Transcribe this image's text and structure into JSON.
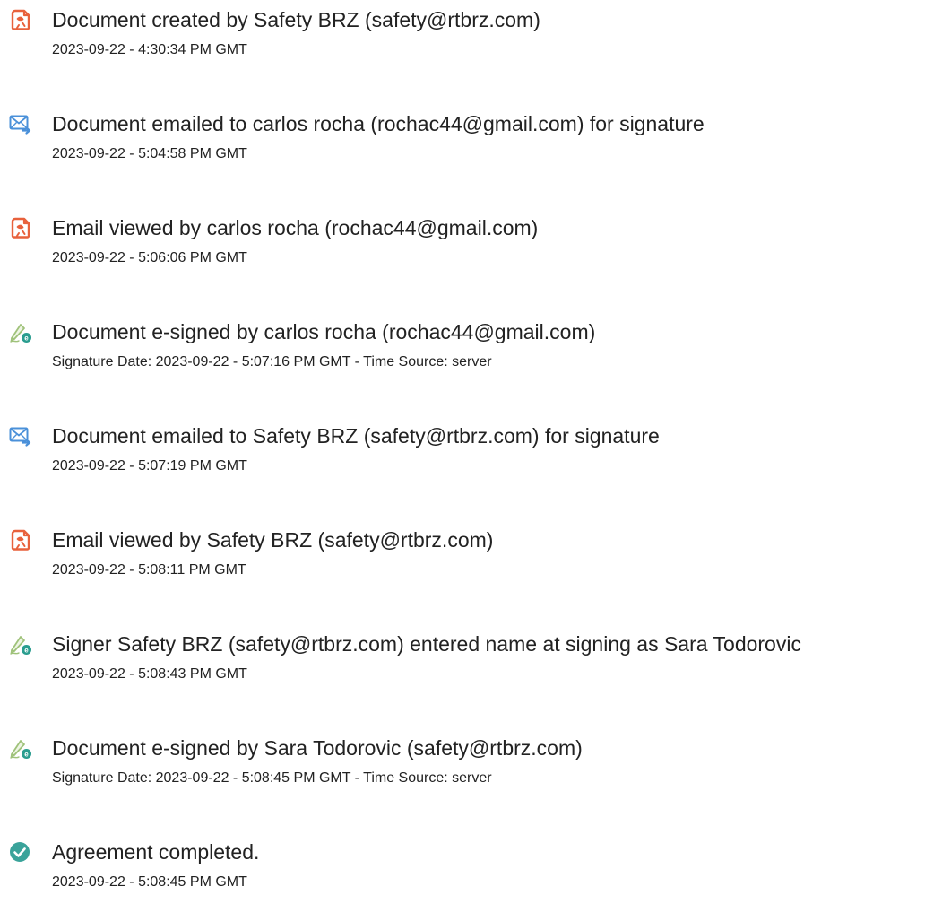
{
  "events": [
    {
      "icon": "document-created-icon",
      "title": "Document created by Safety BRZ (safety@rtbrz.com)",
      "meta": "2023-09-22 - 4:30:34 PM GMT"
    },
    {
      "icon": "email-sent-icon",
      "title": "Document emailed to carlos rocha (rochac44@gmail.com) for signature",
      "meta": "2023-09-22 - 5:04:58 PM GMT"
    },
    {
      "icon": "document-viewed-icon",
      "title": "Email viewed by carlos rocha (rochac44@gmail.com)",
      "meta": "2023-09-22 - 5:06:06 PM GMT"
    },
    {
      "icon": "e-signed-icon",
      "title": "Document e-signed by carlos rocha (rochac44@gmail.com)",
      "meta": "Signature Date: 2023-09-22 - 5:07:16 PM GMT - Time Source: server"
    },
    {
      "icon": "email-sent-icon",
      "title": "Document emailed to Safety BRZ (safety@rtbrz.com) for signature",
      "meta": "2023-09-22 - 5:07:19 PM GMT"
    },
    {
      "icon": "document-viewed-icon",
      "title": "Email viewed by Safety BRZ (safety@rtbrz.com)",
      "meta": "2023-09-22 - 5:08:11 PM GMT"
    },
    {
      "icon": "e-signed-icon",
      "title": "Signer Safety BRZ (safety@rtbrz.com) entered name at signing as Sara Todorovic",
      "meta": "2023-09-22 - 5:08:43 PM GMT"
    },
    {
      "icon": "e-signed-icon",
      "title": "Document e-signed by Sara Todorovic (safety@rtbrz.com)",
      "meta": "Signature Date: 2023-09-22 - 5:08:45 PM GMT - Time Source: server"
    },
    {
      "icon": "agreement-completed-icon",
      "title": "Agreement completed.",
      "meta": "2023-09-22 - 5:08:45 PM GMT"
    }
  ],
  "colors": {
    "text": "#222222",
    "document_icon": "#e8613c",
    "email_icon": "#4a90d9",
    "pen_icon": "#9fc27a",
    "e_badge": "#2a9d8f",
    "check_badge": "#3aa39a"
  }
}
